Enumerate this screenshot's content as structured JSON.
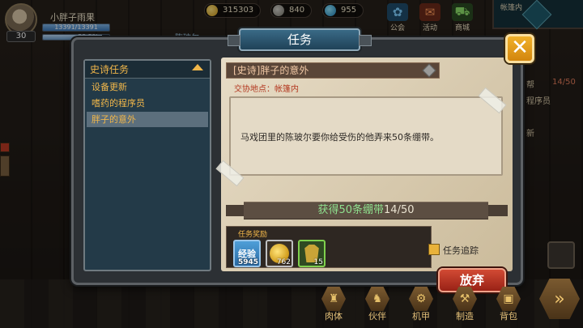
{
  "player": {
    "name": "小胖子雨果",
    "level": "30",
    "hp": "13391/13391",
    "hp_fill": 1.0,
    "xp_percent": "89.5%",
    "xp_fill": 0.895
  },
  "resources": [
    {
      "icon": "gold-coin-icon",
      "value": "315303"
    },
    {
      "icon": "ore-icon",
      "value": "840"
    },
    {
      "icon": "diamond-icon",
      "value": "955"
    }
  ],
  "top_menu": [
    {
      "icon": "guild-icon",
      "label": "公会"
    },
    {
      "icon": "activity-icon",
      "label": "活动"
    },
    {
      "icon": "shop-icon",
      "label": "商城"
    }
  ],
  "minimap": {
    "label": "帐篷内"
  },
  "side_labels": {
    "left_name": "陈玻尔",
    "right_a": "帮",
    "right_b": "14/50",
    "right_c": "程序员",
    "right_d": "新"
  },
  "dialog": {
    "title": "任务",
    "close_icon": "close-x-icon",
    "category": "史诗任务",
    "quests": [
      "设备更新",
      "嗜药的程序员",
      "胖子的意外"
    ],
    "selected_index": 2,
    "quest_title": "[史诗]胖子的意外",
    "location": "交协地点：帐篷内",
    "description": "马戏团里的陈玻尔要你给受伤的他弄来50条绷带。",
    "objective_text": "获得50条绷带",
    "objective_progress": "14/50",
    "rewards_label": "任务奖励",
    "rewards": [
      {
        "icon": "exp-icon",
        "label": "经验",
        "qty": "5945"
      },
      {
        "icon": "gold-pile-icon",
        "label": "",
        "qty": "762"
      },
      {
        "icon": "armor-icon",
        "label": "",
        "qty": "15"
      }
    ],
    "track_label": "任务追踪",
    "abandon_label": "放弃"
  },
  "bottom_bar": [
    {
      "icon": "body-icon",
      "label": "肉体"
    },
    {
      "icon": "partner-icon",
      "label": "伙伴"
    },
    {
      "icon": "mech-icon",
      "label": "机甲"
    },
    {
      "icon": "craft-icon",
      "label": "制造"
    },
    {
      "icon": "backpack-icon",
      "label": "背包"
    }
  ],
  "colors": {
    "accent_orange": "#f0b64a",
    "close_button": "#e89e1c",
    "abandon_button": "#c23a26",
    "progress_green": "#8fe08e"
  }
}
